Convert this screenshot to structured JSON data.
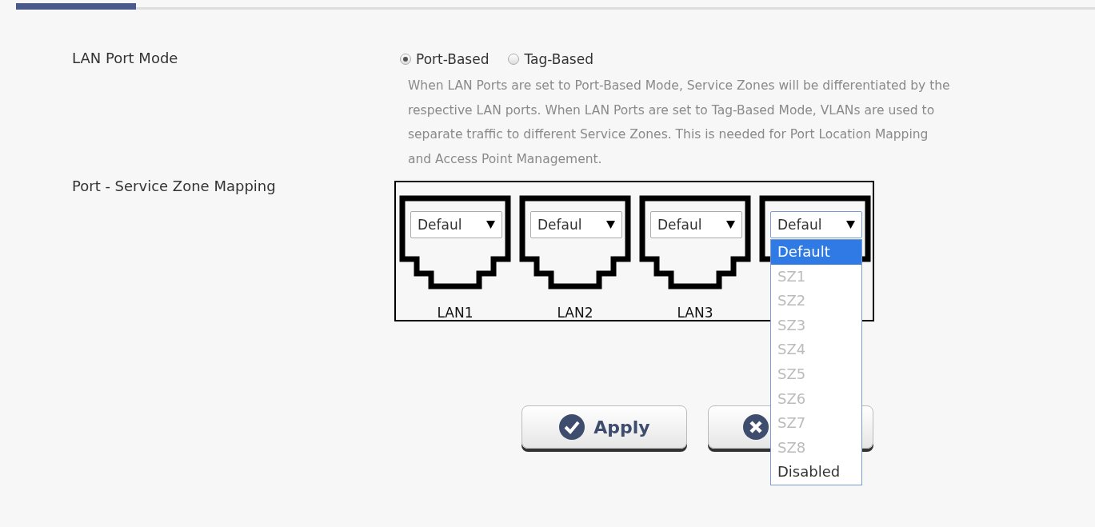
{
  "lan_port_mode": {
    "label": "LAN Port Mode",
    "options": [
      {
        "label": "Port-Based",
        "selected": true
      },
      {
        "label": "Tag-Based",
        "selected": false
      }
    ],
    "description": "When LAN Ports are set to Port-Based Mode, Service Zones will be differentiated by the respective LAN ports. When LAN Ports are set to Tag-Based Mode, VLANs are used to separate traffic to different Service Zones. This is needed for Port Location Mapping and Access Point Management."
  },
  "mapping": {
    "label": "Port - Service Zone Mapping",
    "ports": [
      {
        "value": "Defaul",
        "name": "LAN1",
        "expanded": false
      },
      {
        "value": "Defaul",
        "name": "LAN2",
        "expanded": false
      },
      {
        "value": "Defaul",
        "name": "LAN3",
        "expanded": false
      },
      {
        "value": "Defaul",
        "expanded": true
      }
    ],
    "dropdown_options": [
      {
        "label": "Default",
        "selected": true,
        "disabled": false
      },
      {
        "label": "SZ1",
        "selected": false,
        "disabled": true
      },
      {
        "label": "SZ2",
        "selected": false,
        "disabled": true
      },
      {
        "label": "SZ3",
        "selected": false,
        "disabled": true
      },
      {
        "label": "SZ4",
        "selected": false,
        "disabled": true
      },
      {
        "label": "SZ5",
        "selected": false,
        "disabled": true
      },
      {
        "label": "SZ6",
        "selected": false,
        "disabled": true
      },
      {
        "label": "SZ7",
        "selected": false,
        "disabled": true
      },
      {
        "label": "SZ8",
        "selected": false,
        "disabled": true
      },
      {
        "label": "Disabled",
        "selected": false,
        "disabled": false
      }
    ]
  },
  "buttons": [
    {
      "kind": "apply",
      "label": "Apply"
    },
    {
      "kind": "cancel"
    }
  ]
}
